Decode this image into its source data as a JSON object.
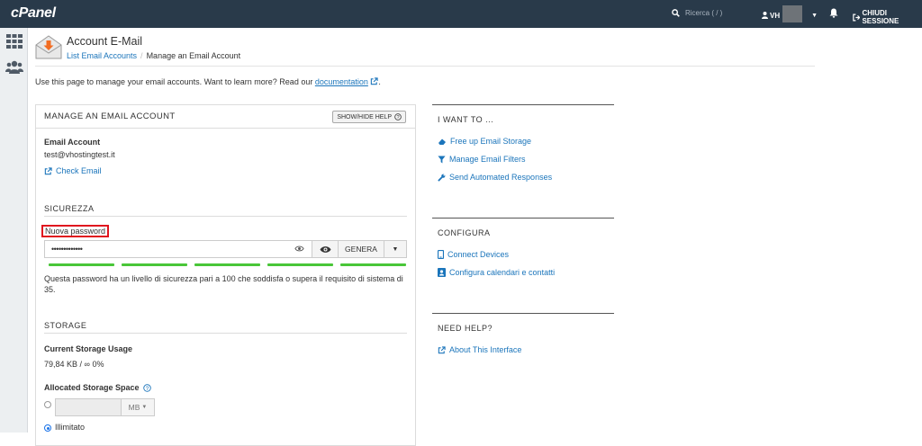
{
  "topbar": {
    "logo": "cPanel",
    "search_placeholder": "Ricerca ( / )",
    "user": "VH",
    "logout": "CHIUDI SESSIONE"
  },
  "sidebar": {
    "items": [
      {
        "icon": "grid-icon"
      },
      {
        "icon": "users-icon"
      }
    ]
  },
  "header": {
    "title": "Account E-Mail",
    "breadcrumb": [
      "List Email Accounts",
      "Manage an Email Account"
    ],
    "intro_text": "Use this page to manage your email accounts. Want to learn more? Read our ",
    "intro_link": "documentation",
    "intro_end": "."
  },
  "panel": {
    "title": "MANAGE AN EMAIL ACCOUNT",
    "help_button": "SHOW/HIDE HELP",
    "email_label": "Email Account",
    "email_value": "test@vhostingtest.it",
    "check_email": "Check Email",
    "security_title": "SICUREZZA",
    "password_label": "Nuova password",
    "password_value": "•••••••••••••",
    "generate_button": "GENERA",
    "strength_segments": 5,
    "strength_text": "Questa password ha un livello di sicurezza pari a 100 che soddisfa o supera il requisito di sistema di 35.",
    "storage_title": "STORAGE",
    "usage_label": "Current Storage Usage",
    "usage_value": "79,84 KB / ∞ 0%",
    "allocated_label": "Allocated Storage Space",
    "unit": "MB",
    "unlimited": "Illimitato"
  },
  "right": {
    "i_want_to": {
      "title": "I WANT TO ...",
      "links": [
        "Free up Email Storage",
        "Manage Email Filters",
        "Send Automated Responses"
      ]
    },
    "configure": {
      "title": "CONFIGURA",
      "links": [
        "Connect Devices",
        "Configura calendari e contatti"
      ]
    },
    "help": {
      "title": "NEED HELP?",
      "links": [
        "About This Interface"
      ]
    }
  },
  "colors": {
    "topbar": "#293a4a",
    "link": "#1b75bb",
    "strength": "#49c638",
    "highlight": "#e0141e"
  }
}
